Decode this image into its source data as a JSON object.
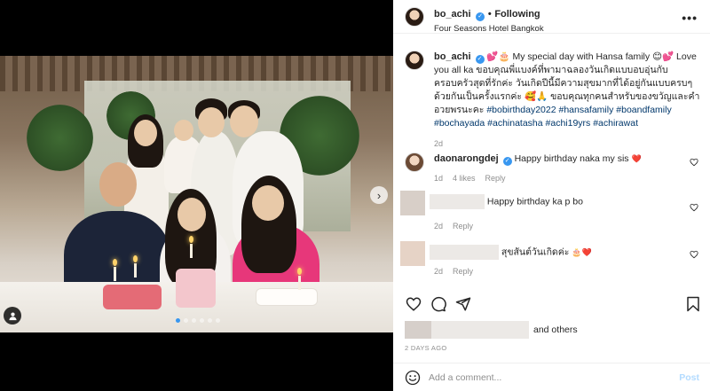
{
  "post": {
    "username": "bo_achi",
    "verified": true,
    "follow_status": "Following",
    "location": "Four Seasons Hotel Bangkok",
    "separator": "•",
    "more_glyph": "•••"
  },
  "caption": {
    "username": "bo_achi",
    "emoji_lead": "💕🎂",
    "text_1": "My special day with Hansa family",
    "emoji_mid": "😊💕",
    "text_2": "Love you all ka ขอบคุณพี่แบงค์ที่พามาฉลองวันเกิดแบบอบอุ่นกับครอบครัวสุดที่รักค่ะ วันเกิดปีนี้มีความสุขมากที่ได้อยู่กันแบบครบๆด้วยกันเป็นครั้งแรกค่ะ",
    "emoji_after": "🥰🙏",
    "text_3": "ขอบคุณทุกคนสำหรับของขวัญและคำอวยพรนะคะ",
    "hashtags": "#bobirthday2022 #hansafamily #boandfamily #bochayada #achinatasha #achi19yrs #achirawat",
    "timestamp": "2d"
  },
  "comments": [
    {
      "username": "daonarongdej",
      "verified": true,
      "text": "Happy birthday naka my sis",
      "emoji": "❤️",
      "time": "1d",
      "likes": "4 likes",
      "reply": "Reply"
    },
    {
      "username": "",
      "text": "Happy birthday ka p bo",
      "time": "2d",
      "reply": "Reply"
    },
    {
      "username": "",
      "text": "สุขสันต์วันเกิดค่ะ",
      "emoji": "🎂❤️",
      "time": "2d",
      "reply": "Reply"
    }
  ],
  "likes_summary": {
    "text": "and others"
  },
  "posted_ago": "2 DAYS AGO",
  "composer": {
    "placeholder": "Add a comment...",
    "post_label": "Post"
  },
  "carousel": {
    "count": 6,
    "active_index": 0
  },
  "colors": {
    "accent": "#3897f0",
    "link": "#00376b",
    "muted": "#8e8e8e",
    "post_disabled": "#b3dbff"
  },
  "icons": [
    "more-icon",
    "verified-icon",
    "heart-icon",
    "comment-icon",
    "share-icon",
    "save-icon",
    "emoji-icon",
    "chevron-right-icon",
    "user-tag-icon"
  ]
}
